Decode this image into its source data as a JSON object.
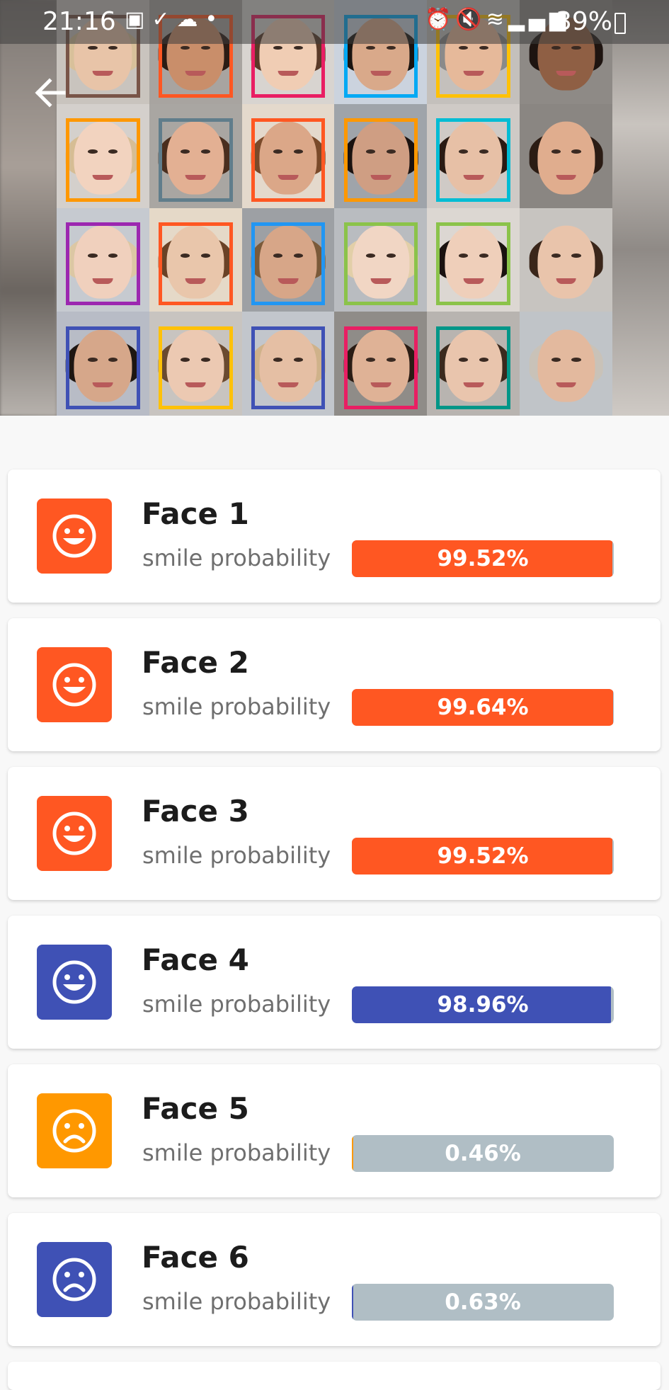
{
  "status_bar": {
    "time": "21:16",
    "left_icons": [
      "image-icon",
      "check-icon",
      "cloud-icon",
      "dot-icon"
    ],
    "right_icons": [
      "alarm-icon",
      "mute-icon",
      "wifi-icon",
      "signal-icon"
    ],
    "battery": "39%"
  },
  "header": {
    "back_icon": "arrow-left-icon"
  },
  "faces": [
    {
      "title": "Face 1",
      "label": "smile probability",
      "percent": "99.52%",
      "value": 0.9952,
      "color": "#ff5722",
      "icon": "smile-icon"
    },
    {
      "title": "Face 2",
      "label": "smile probability",
      "percent": "99.64%",
      "value": 0.9964,
      "color": "#ff5722",
      "icon": "smile-icon"
    },
    {
      "title": "Face 3",
      "label": "smile probability",
      "percent": "99.52%",
      "value": 0.9952,
      "color": "#ff5722",
      "icon": "smile-icon"
    },
    {
      "title": "Face 4",
      "label": "smile probability",
      "percent": "98.96%",
      "value": 0.9896,
      "color": "#3f51b5",
      "icon": "smile-icon"
    },
    {
      "title": "Face 5",
      "label": "smile probability",
      "percent": "0.46%",
      "value": 0.0046,
      "color": "#ff9800",
      "icon": "frown-icon"
    },
    {
      "title": "Face 6",
      "label": "smile probability",
      "percent": "0.63%",
      "value": 0.0063,
      "color": "#3f51b5",
      "icon": "frown-icon"
    }
  ],
  "colors": {
    "bar_track": "#b0bec5",
    "box_colors": [
      "#795548",
      "#ff5722",
      "#e91e63",
      "#03a9f4",
      "#ffc107",
      "#ff9800",
      "#607d8b",
      "#ff5722",
      "#ff9800",
      "#00bcd4",
      "#9c27b0",
      "#ff5722",
      "#2196f3",
      "#8bc34a",
      "#8bc34a",
      "#3f51b5",
      "#ffc107",
      "#3f51b5",
      "#e91e63",
      "#009688"
    ]
  }
}
